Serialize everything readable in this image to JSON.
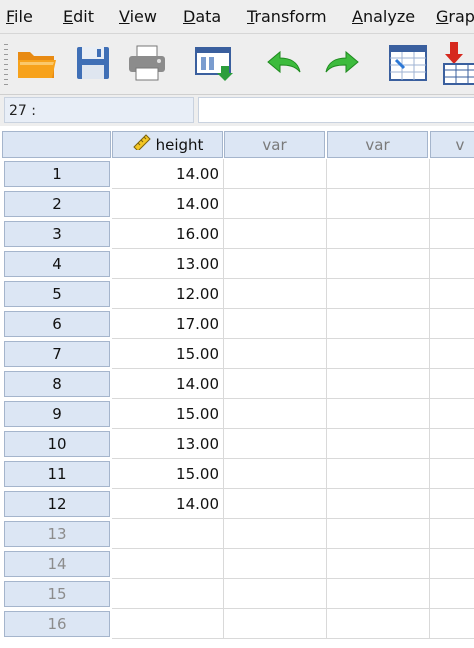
{
  "menu": [
    {
      "mnemonic": "F",
      "rest": "ile"
    },
    {
      "mnemonic": "E",
      "rest": "dit"
    },
    {
      "mnemonic": "V",
      "rest": "iew"
    },
    {
      "mnemonic": "D",
      "rest": "ata"
    },
    {
      "mnemonic": "T",
      "rest": "ransform"
    },
    {
      "mnemonic": "A",
      "rest": "nalyze"
    },
    {
      "mnemonic": "G",
      "rest": "rap"
    }
  ],
  "toolbar": {
    "icons": [
      "open-folder-icon",
      "save-icon",
      "print-icon",
      "dialog-recall-icon",
      "undo-icon",
      "redo-icon",
      "go-to-case-icon",
      "insert-variable-icon"
    ],
    "colors": {
      "accent": "#dce6f4",
      "undo": "#3dbb3d",
      "folder": "#f7a21b"
    }
  },
  "editor": {
    "cell_ref": "27 :",
    "cell_value": ""
  },
  "grid": {
    "columns": [
      {
        "label": "height",
        "measure_icon": "ruler-icon",
        "named": true
      },
      {
        "label": "var",
        "named": false
      },
      {
        "label": "var",
        "named": false
      },
      {
        "label": "v",
        "named": false
      }
    ],
    "rows": [
      {
        "num": "1",
        "height": "14.00"
      },
      {
        "num": "2",
        "height": "14.00"
      },
      {
        "num": "3",
        "height": "16.00"
      },
      {
        "num": "4",
        "height": "13.00"
      },
      {
        "num": "5",
        "height": "12.00"
      },
      {
        "num": "6",
        "height": "17.00"
      },
      {
        "num": "7",
        "height": "15.00"
      },
      {
        "num": "8",
        "height": "14.00"
      },
      {
        "num": "9",
        "height": "15.00"
      },
      {
        "num": "10",
        "height": "13.00"
      },
      {
        "num": "11",
        "height": "15.00"
      },
      {
        "num": "12",
        "height": "14.00"
      },
      {
        "num": "13",
        "height": ""
      },
      {
        "num": "14",
        "height": ""
      },
      {
        "num": "15",
        "height": ""
      },
      {
        "num": "16",
        "height": ""
      }
    ]
  }
}
